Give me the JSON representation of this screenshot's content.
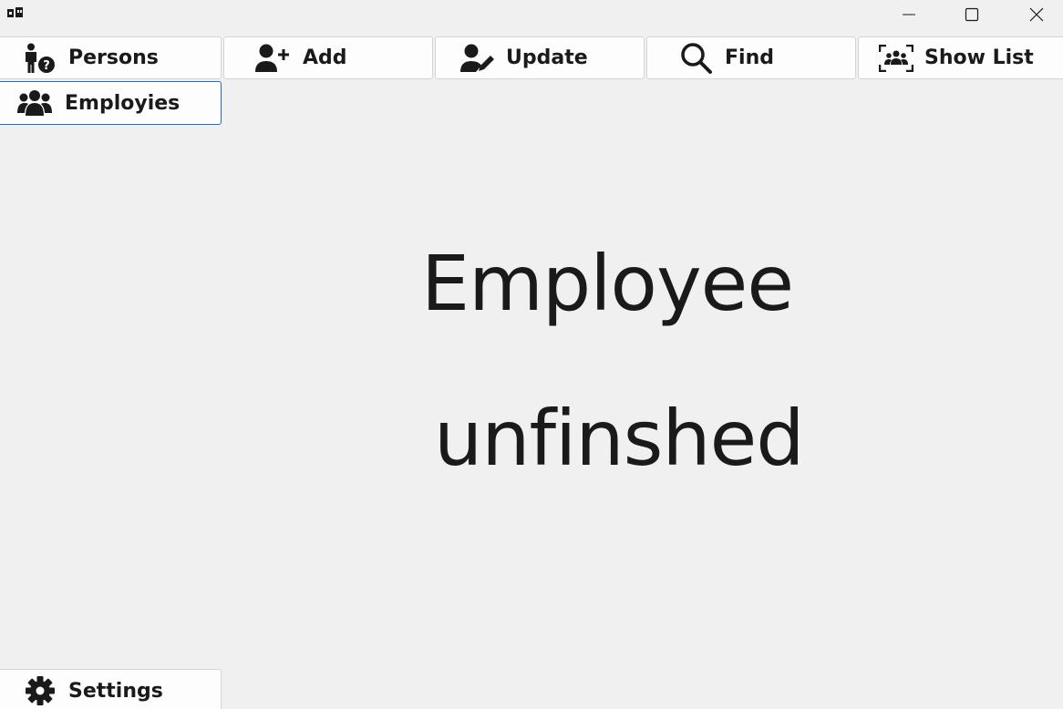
{
  "window": {
    "controls": {
      "minimize_icon": "minimize-icon",
      "maximize_icon": "maximize-icon",
      "close_icon": "close-icon"
    }
  },
  "toolbar": {
    "persons_label": "Persons",
    "add_label": "Add",
    "update_label": "Update",
    "find_label": "Find",
    "show_list_label": "Show List"
  },
  "sidebar": {
    "employies_label": "Employies",
    "settings_label": "Settings"
  },
  "main": {
    "title_line1": "Employee",
    "title_line2": "unfinshed"
  },
  "colors": {
    "background": "#f0f0f0",
    "button_bg": "#fdfdfd",
    "selected_border": "#1f6fb8",
    "text": "#1a1a1a"
  }
}
